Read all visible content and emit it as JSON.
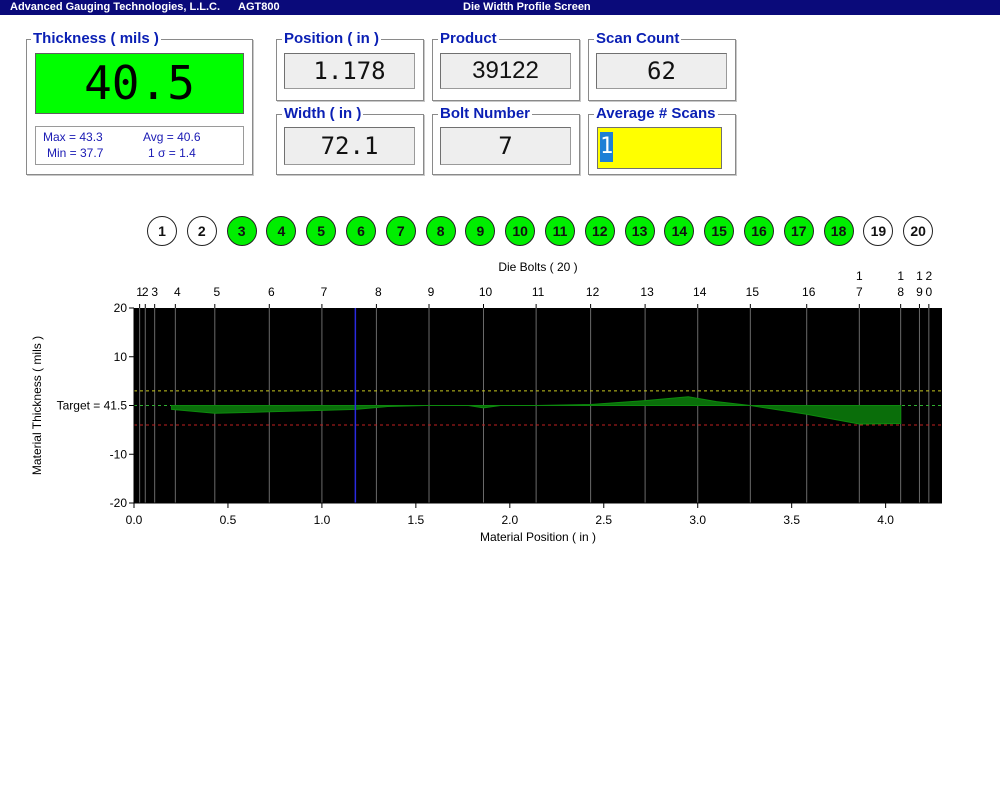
{
  "titlebar": {
    "company": "Advanced Gauging Technologies, L.L.C.",
    "model": "AGT800",
    "screen": "Die Width Profile Screen"
  },
  "thickness": {
    "title": "Thickness ( mils )",
    "value": "40.5",
    "max": "Max = 43.3",
    "avg": "Avg = 40.6",
    "min": "Min = 37.7",
    "sigma": "1 σ = 1.4",
    "display_color": "#00ff00"
  },
  "position": {
    "title": "Position ( in )",
    "value": "1.178"
  },
  "product": {
    "title": "Product",
    "value": "39122"
  },
  "scan_count": {
    "title": "Scan Count",
    "value": "62"
  },
  "width": {
    "title": "Width ( in )",
    "value": "72.1"
  },
  "bolt_number": {
    "title": "Bolt Number",
    "value": "7"
  },
  "average_scans": {
    "title": "Average # Scans",
    "value": "1",
    "field_color": "#ffff00",
    "cursor_color": "#1e7fd6"
  },
  "bolts": [
    {
      "label": "1",
      "active": false
    },
    {
      "label": "2",
      "active": false
    },
    {
      "label": "3",
      "active": true
    },
    {
      "label": "4",
      "active": true
    },
    {
      "label": "5",
      "active": true
    },
    {
      "label": "6",
      "active": true
    },
    {
      "label": "7",
      "active": true
    },
    {
      "label": "8",
      "active": true
    },
    {
      "label": "9",
      "active": true
    },
    {
      "label": "10",
      "active": true
    },
    {
      "label": "11",
      "active": true
    },
    {
      "label": "12",
      "active": true
    },
    {
      "label": "13",
      "active": true
    },
    {
      "label": "14",
      "active": true
    },
    {
      "label": "15",
      "active": true
    },
    {
      "label": "16",
      "active": true
    },
    {
      "label": "17",
      "active": true
    },
    {
      "label": "18",
      "active": true
    },
    {
      "label": "19",
      "active": false
    },
    {
      "label": "20",
      "active": false
    }
  ],
  "colors": {
    "active_bolt": "#00ee00",
    "inactive_bolt": "#ffffff",
    "profile_fill": "#0a6e0a",
    "plot_bg": "#000000"
  },
  "chart_data": {
    "type": "area",
    "title": "Die Bolts ( 20 )",
    "xlabel": "Material Position ( in )",
    "ylabel": "Material Thickness ( mils )",
    "xlim": [
      0.0,
      4.3
    ],
    "ylim": [
      -20,
      20
    ],
    "xticks": [
      "0.0",
      "0.5",
      "1.0",
      "1.5",
      "2.0",
      "2.5",
      "3.0",
      "3.5",
      "4.0"
    ],
    "yticks": [
      "20",
      "10",
      "Target = 41.5",
      "-10",
      "-20"
    ],
    "target_label": "Target = 41.5",
    "upper_limit": 3,
    "lower_limit": -4,
    "current_position": 1.178,
    "bolt_lines": [
      {
        "label": "1",
        "x": 0.03
      },
      {
        "label": "2",
        "x": 0.06
      },
      {
        "label": "3",
        "x": 0.11
      },
      {
        "label": "4",
        "x": 0.22
      },
      {
        "label": "5",
        "x": 0.43
      },
      {
        "label": "6",
        "x": 0.72
      },
      {
        "label": "7",
        "x": 1.0
      },
      {
        "label": "8",
        "x": 1.29
      },
      {
        "label": "9",
        "x": 1.57
      },
      {
        "label": "10",
        "x": 1.86
      },
      {
        "label": "11",
        "x": 2.14
      },
      {
        "label": "12",
        "x": 2.43
      },
      {
        "label": "13",
        "x": 2.72
      },
      {
        "label": "14",
        "x": 3.0
      },
      {
        "label": "15",
        "x": 3.28
      },
      {
        "label": "16",
        "x": 3.58
      },
      {
        "label": "17",
        "x": 3.86
      },
      {
        "label": "18",
        "x": 4.08
      },
      {
        "label": "19",
        "x": 4.18
      },
      {
        "label": "20",
        "x": 4.23
      }
    ],
    "profile": [
      [
        0.2,
        -0.8
      ],
      [
        0.43,
        -1.6
      ],
      [
        0.72,
        -1.3
      ],
      [
        1.0,
        -1.0
      ],
      [
        1.18,
        -0.8
      ],
      [
        1.35,
        -0.2
      ],
      [
        1.55,
        0
      ],
      [
        1.78,
        0
      ],
      [
        1.86,
        -0.5
      ],
      [
        1.95,
        0
      ],
      [
        2.14,
        0
      ],
      [
        2.43,
        0.2
      ],
      [
        2.72,
        1.0
      ],
      [
        2.95,
        1.8
      ],
      [
        3.1,
        0.8
      ],
      [
        3.28,
        0
      ],
      [
        3.58,
        -1.8
      ],
      [
        3.86,
        -3.8
      ],
      [
        4.08,
        -3.7
      ],
      [
        4.08,
        0
      ],
      [
        3.86,
        0
      ],
      [
        3.58,
        0
      ],
      [
        3.28,
        0
      ],
      [
        3.1,
        0
      ],
      [
        2.95,
        0
      ],
      [
        2.72,
        0
      ],
      [
        2.43,
        0
      ],
      [
        2.14,
        0
      ],
      [
        1.95,
        0
      ],
      [
        1.86,
        0
      ],
      [
        1.78,
        0
      ],
      [
        1.55,
        0
      ],
      [
        1.35,
        0
      ],
      [
        1.18,
        0
      ],
      [
        1.0,
        0
      ],
      [
        0.72,
        0
      ],
      [
        0.43,
        0
      ],
      [
        0.2,
        0
      ]
    ]
  }
}
